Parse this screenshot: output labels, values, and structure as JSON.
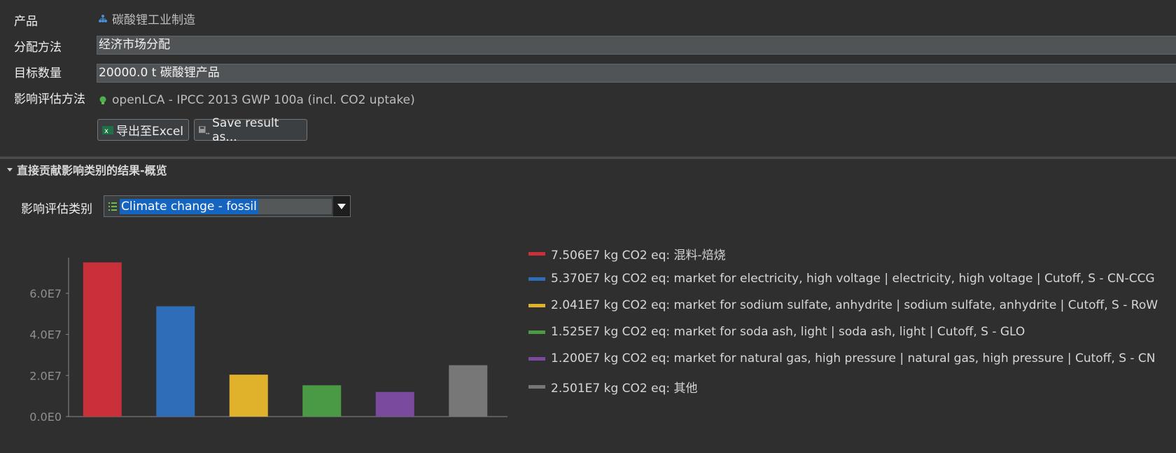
{
  "labels": {
    "product": "产品",
    "allocation": "分配方法",
    "target": "目标数量",
    "lcia_method": "影响评估方法"
  },
  "product_value": "碳酸锂工业制造",
  "allocation_value": "经济市场分配",
  "target_value": "20000.0 t 碳酸锂产品",
  "lcia_method_value": "openLCA - IPCC 2013 GWP 100a (incl. CO2 uptake)",
  "buttons": {
    "export_excel": "导出至Excel",
    "save_result": "Save result as..."
  },
  "section": {
    "title": "直接贡献影响类别的结果-概览",
    "category_label": "影响评估类别",
    "category_selected": "Climate change - fossil"
  },
  "chart_data": {
    "type": "bar",
    "yticks": [
      "0.0E0",
      "2.0E7",
      "4.0E7",
      "6.0E7"
    ],
    "ylim": [
      0,
      76000000
    ],
    "values": [
      75060000,
      53700000,
      20410000,
      15250000,
      12000000,
      25010000
    ],
    "colors": [
      "#c9303a",
      "#2f6db8",
      "#e0b12b",
      "#4a9a45",
      "#7a4a9e",
      "#777777"
    ],
    "legend": [
      "7.506E7 kg CO2 eq: 混料-焙烧",
      "5.370E7 kg CO2 eq: market for electricity, high voltage | electricity, high voltage | Cutoff, S - CN-CCG",
      "2.041E7 kg CO2 eq: market for sodium sulfate, anhydrite | sodium sulfate, anhydrite | Cutoff, S - RoW",
      "1.525E7 kg CO2 eq: market for soda ash, light | soda ash, light | Cutoff, S - GLO",
      "1.200E7 kg CO2 eq: market for natural gas, high pressure | natural gas, high pressure | Cutoff, S - CN",
      "2.501E7 kg CO2 eq: 其他"
    ]
  }
}
